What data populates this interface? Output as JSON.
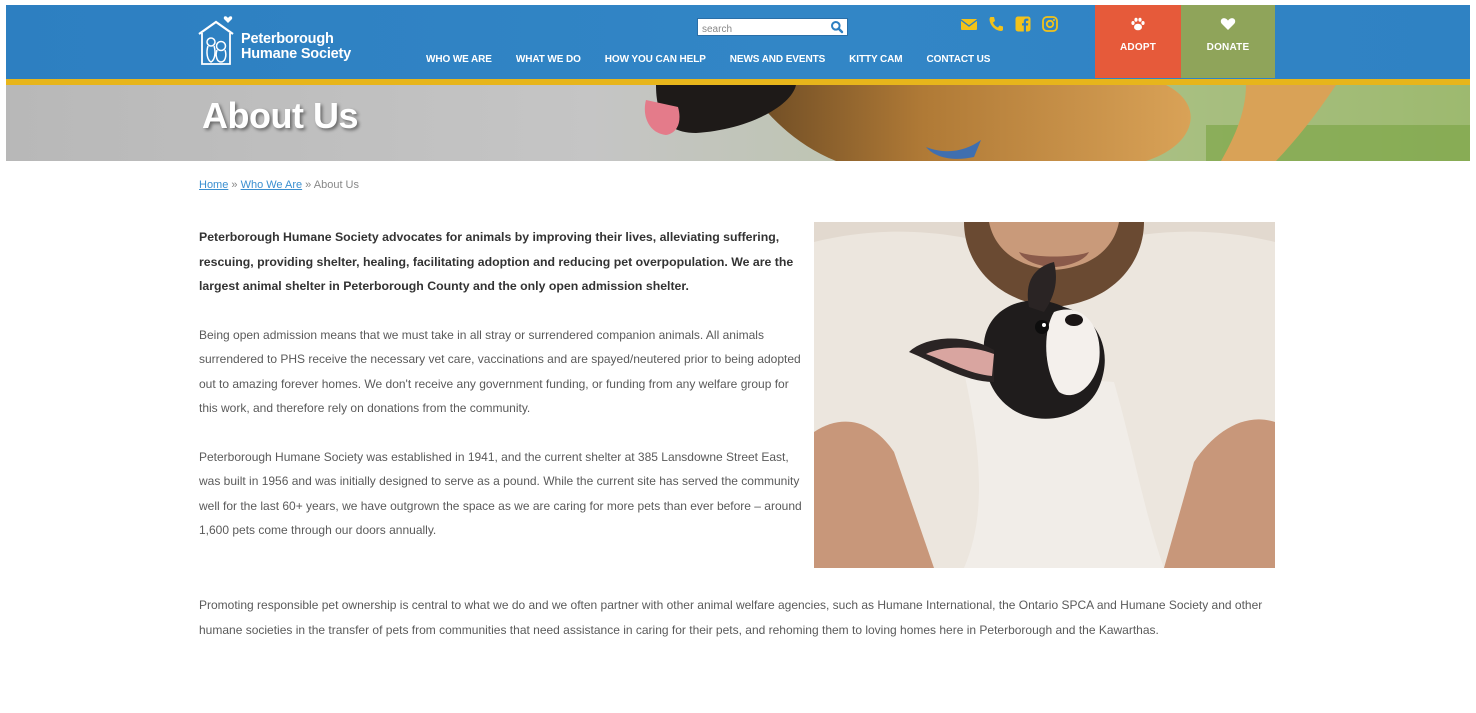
{
  "header": {
    "logo_line1": "Peterborough",
    "logo_line2": "Humane Society",
    "search_placeholder": "search",
    "nav": [
      "WHO WE ARE",
      "WHAT WE DO",
      "HOW YOU CAN HELP",
      "NEWS AND EVENTS",
      "KITTY CAM",
      "CONTACT US"
    ],
    "social_icons": [
      "email-icon",
      "phone-icon",
      "facebook-icon",
      "instagram-icon"
    ],
    "adopt_label": "ADOPT",
    "donate_label": "DONATE"
  },
  "hero": {
    "title": "About Us"
  },
  "breadcrumb": {
    "home": "Home",
    "sep1": " » ",
    "who": "Who We Are",
    "sep2": " » ",
    "current": "About Us"
  },
  "content": {
    "lead": "Peterborough Humane Society advocates for animals by improving their lives, alleviating suffering, rescuing, providing shelter, healing, facilitating adoption and reducing pet overpopulation. We are the largest animal shelter in Peterborough County and the only open admission shelter.",
    "p1": "Being open admission means that we must take in all stray or surrendered companion animals. All animals surrendered to PHS receive the necessary vet care, vaccinations and are spayed/neutered prior to being adopted out to amazing forever homes. We don't receive any government funding, or funding from any welfare group for this work, and therefore rely on donations from the community.",
    "p2": "Peterborough Humane Society was established in 1941, and the current shelter at 385 Lansdowne Street East, was built in 1956 and was initially designed to serve as a pound. While the current site has served the community well for the last 60+ years, we have outgrown the space as we are caring for more pets than ever before – around 1,600 pets come through our doors annually.",
    "p3": "Promoting responsible pet ownership is central to what we do and we often partner with other animal welfare agencies, such as Humane International, the Ontario SPCA and Humane Society and other humane societies in the transfer of pets from communities that need assistance in caring for their pets, and rehoming them to loving homes here in Peterborough and the Kawarthas."
  },
  "colors": {
    "header_blue": "#2d7fc1",
    "band_yellow": "#e7b51b",
    "adopt_orange": "#e65a3a",
    "donate_green": "#8fa45a",
    "social_yellow": "#f2c21a",
    "link_blue": "#3a8fd0"
  }
}
